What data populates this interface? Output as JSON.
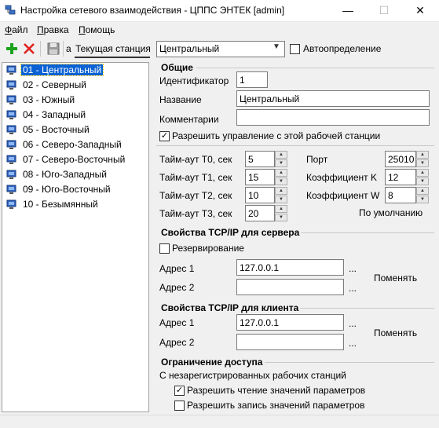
{
  "window": {
    "title": "Настройка сетевого взаимодействия - ЦППС ЭНТЕК [admin]",
    "min_glyph": "—",
    "max_glyph": "☐",
    "close_glyph": "✕"
  },
  "menu": [
    {
      "label": "Файл"
    },
    {
      "label": "Правка"
    },
    {
      "label": "Помощь"
    }
  ],
  "toolbar": {
    "current_station_label": "Текущая станция",
    "prefix_char": "а",
    "station_value": "Центральный",
    "auto_detect_label": "Автоопределение",
    "auto_detect_checked": false,
    "add_color": "#1aa31a",
    "delete_color": "#e02020"
  },
  "stations": [
    {
      "label": "01 - Центральный",
      "selected": true
    },
    {
      "label": "02 - Северный",
      "selected": false
    },
    {
      "label": "03 - Южный",
      "selected": false
    },
    {
      "label": "04 - Западный",
      "selected": false
    },
    {
      "label": "05 - Восточный",
      "selected": false
    },
    {
      "label": "06 - Северо-Западный",
      "selected": false
    },
    {
      "label": "07 - Северо-Восточный",
      "selected": false
    },
    {
      "label": "08 - Юго-Западный",
      "selected": false
    },
    {
      "label": "09 - Юго-Восточный",
      "selected": false
    },
    {
      "label": "10 - Безымянный",
      "selected": false
    }
  ],
  "general": {
    "title": "Общие",
    "id_label": "Идентификатор",
    "id_value": "1",
    "name_label": "Название",
    "name_value": "Центральный",
    "comment_label": "Комментарии",
    "comment_value": "",
    "allow_control_label": "Разрешить управление с этой рабочей станции",
    "allow_control_checked": true
  },
  "timeouts": {
    "t0_label": "Тайм-аут Т0, сек",
    "t0_value": "5",
    "t1_label": "Тайм-аут Т1, сек",
    "t1_value": "15",
    "t2_label": "Тайм-аут Т2, сек",
    "t2_value": "10",
    "t3_label": "Тайм-аут Т3, сек",
    "t3_value": "20",
    "port_label": "Порт",
    "port_value": "25010",
    "k_label": "Коэффициент K",
    "k_value": "12",
    "w_label": "Коэффициент W",
    "w_value": "8",
    "defaults_label": "По умолчанию"
  },
  "server_tcp": {
    "title": "Свойства TCP/IP для сервера",
    "reserve_label": "Резервирование",
    "reserve_checked": false,
    "addr1_label": "Адрес 1",
    "addr1_value": "127.0.0.1",
    "addr2_label": "Адрес 2",
    "addr2_value": "",
    "ellipsis": "...",
    "change_label": "Поменять"
  },
  "client_tcp": {
    "title": "Свойства TCP/IP для клиента",
    "addr1_label": "Адрес 1",
    "addr1_value": "127.0.0.1",
    "addr2_label": "Адрес 2",
    "addr2_value": "",
    "ellipsis": "...",
    "change_label": "Поменять"
  },
  "access": {
    "title": "Ограничение доступа",
    "subtitle": "С незарегистрированных рабочих станций",
    "read_label": "Разрешить чтение значений параметров",
    "read_checked": true,
    "write_label": "Разрешить запись значений параметров",
    "write_checked": false
  }
}
